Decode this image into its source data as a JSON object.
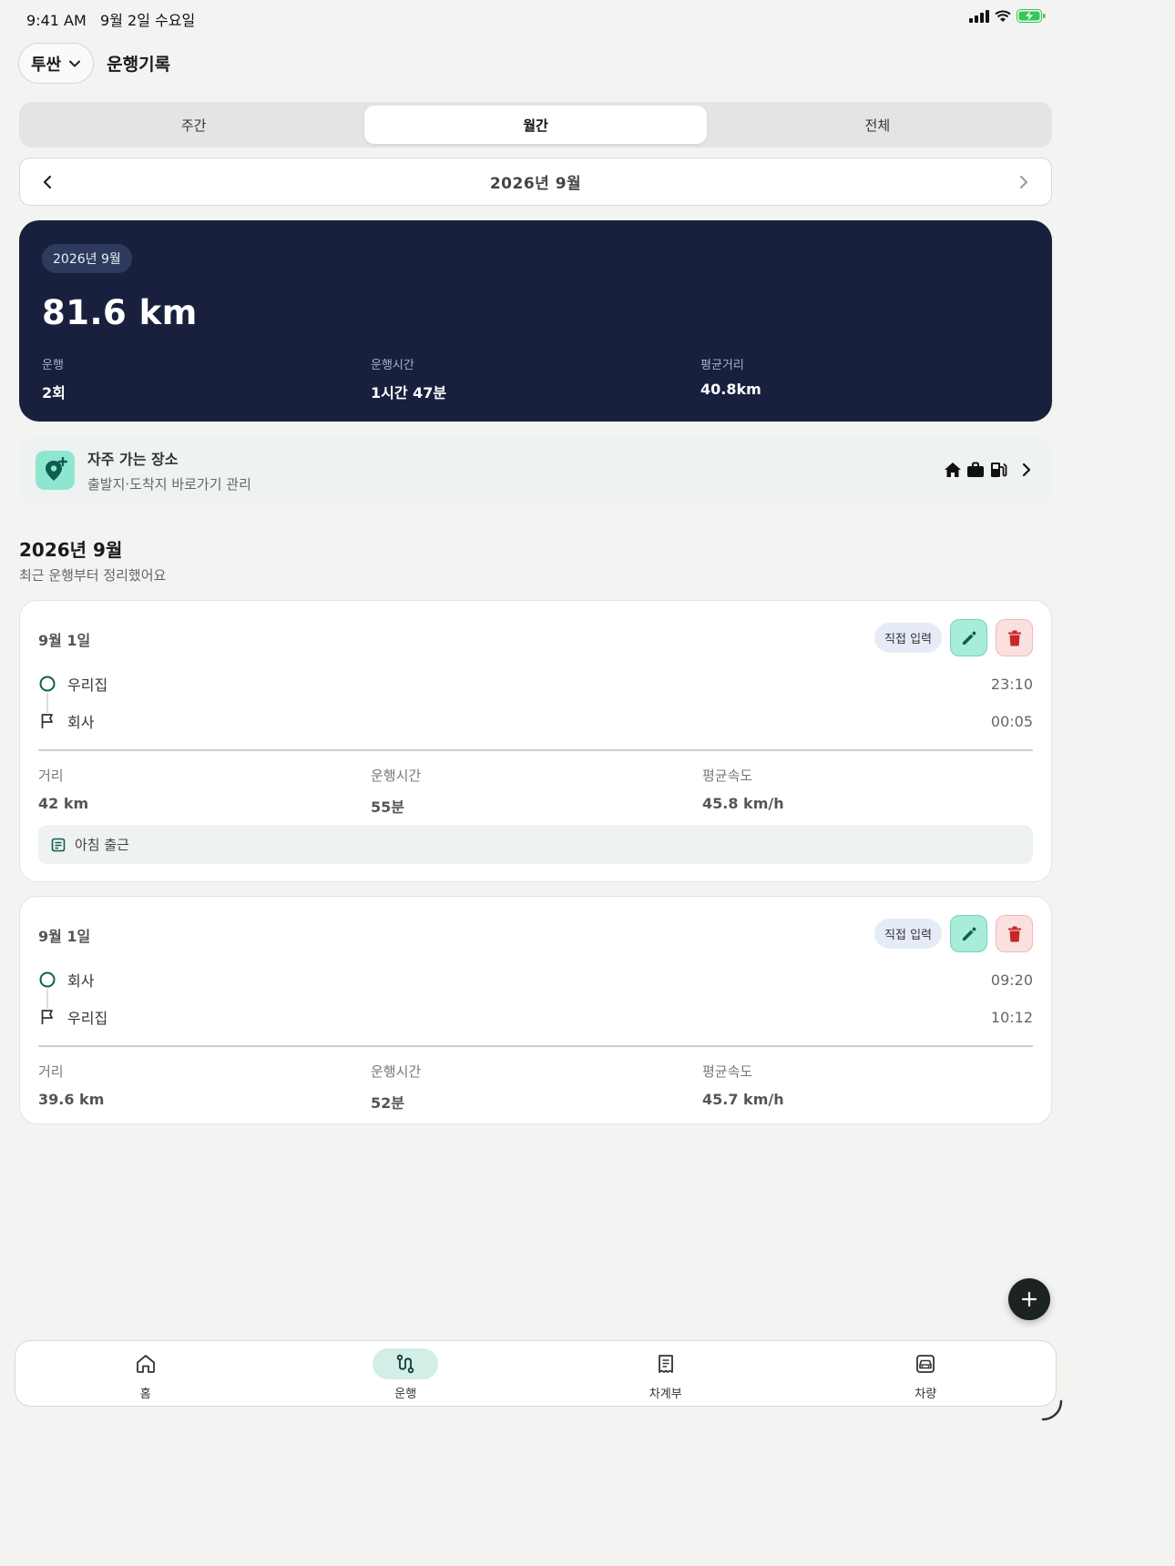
{
  "status_bar": {
    "time": "9:41 AM",
    "date": "9월 2일 수요일",
    "icons": [
      "signal-icon",
      "wifi-icon",
      "battery-charging-icon"
    ]
  },
  "header": {
    "vehicle": "투싼",
    "title": "운행기록"
  },
  "period_tabs": [
    {
      "label": "주간",
      "active": false
    },
    {
      "label": "월간",
      "active": true
    },
    {
      "label": "전체",
      "active": false
    }
  ],
  "month_nav": {
    "label": "2026년 9월"
  },
  "summary": {
    "period": "2026년 9월",
    "total_distance": "81.6 km",
    "stats": [
      {
        "label": "운행",
        "value": "2회"
      },
      {
        "label": "운행시간",
        "value": "1시간 47분"
      },
      {
        "label": "평균거리",
        "value": "40.8km"
      }
    ],
    "colors": {
      "background": "#19203d"
    }
  },
  "frequent_places": {
    "title": "자주 가는 장소",
    "subtitle": "출발지·도착지 바로가기 관리",
    "icons": [
      "home-icon",
      "briefcase-icon",
      "gas-station-icon",
      "chevron-right-icon"
    ]
  },
  "list": {
    "title": "2026년 9월",
    "subtitle": "최근 운행부터 정리했어요",
    "trips": [
      {
        "date": "9월 1일",
        "badge": "직접 입력",
        "start": {
          "place": "우리집",
          "time": "23:10"
        },
        "end": {
          "place": "회사",
          "time": "00:05"
        },
        "metrics": [
          {
            "label": "거리",
            "value": "42 km"
          },
          {
            "label": "운행시간",
            "value": "55분"
          },
          {
            "label": "평균속도",
            "value": "45.8 km/h"
          }
        ],
        "memo": "아침 출근"
      },
      {
        "date": "9월 1일",
        "badge": "직접 입력",
        "start": {
          "place": "회사",
          "time": "09:20"
        },
        "end": {
          "place": "우리집",
          "time": "10:12"
        },
        "metrics": [
          {
            "label": "거리",
            "value": "39.6 km"
          },
          {
            "label": "운행시간",
            "value": "52분"
          },
          {
            "label": "평균속도",
            "value": "45.7 km/h"
          }
        ]
      }
    ]
  },
  "bottom_nav": [
    {
      "label": "홈",
      "icon": "home-icon",
      "active": false
    },
    {
      "label": "운행",
      "icon": "route-icon",
      "active": true
    },
    {
      "label": "차계부",
      "icon": "receipt-icon",
      "active": false
    },
    {
      "label": "차량",
      "icon": "car-icon",
      "active": false
    }
  ],
  "colors": {
    "accent": "#8ee6d0",
    "accent_dark": "#0d5e4f",
    "delete": "#c62828",
    "background": "#f3f3f1"
  }
}
